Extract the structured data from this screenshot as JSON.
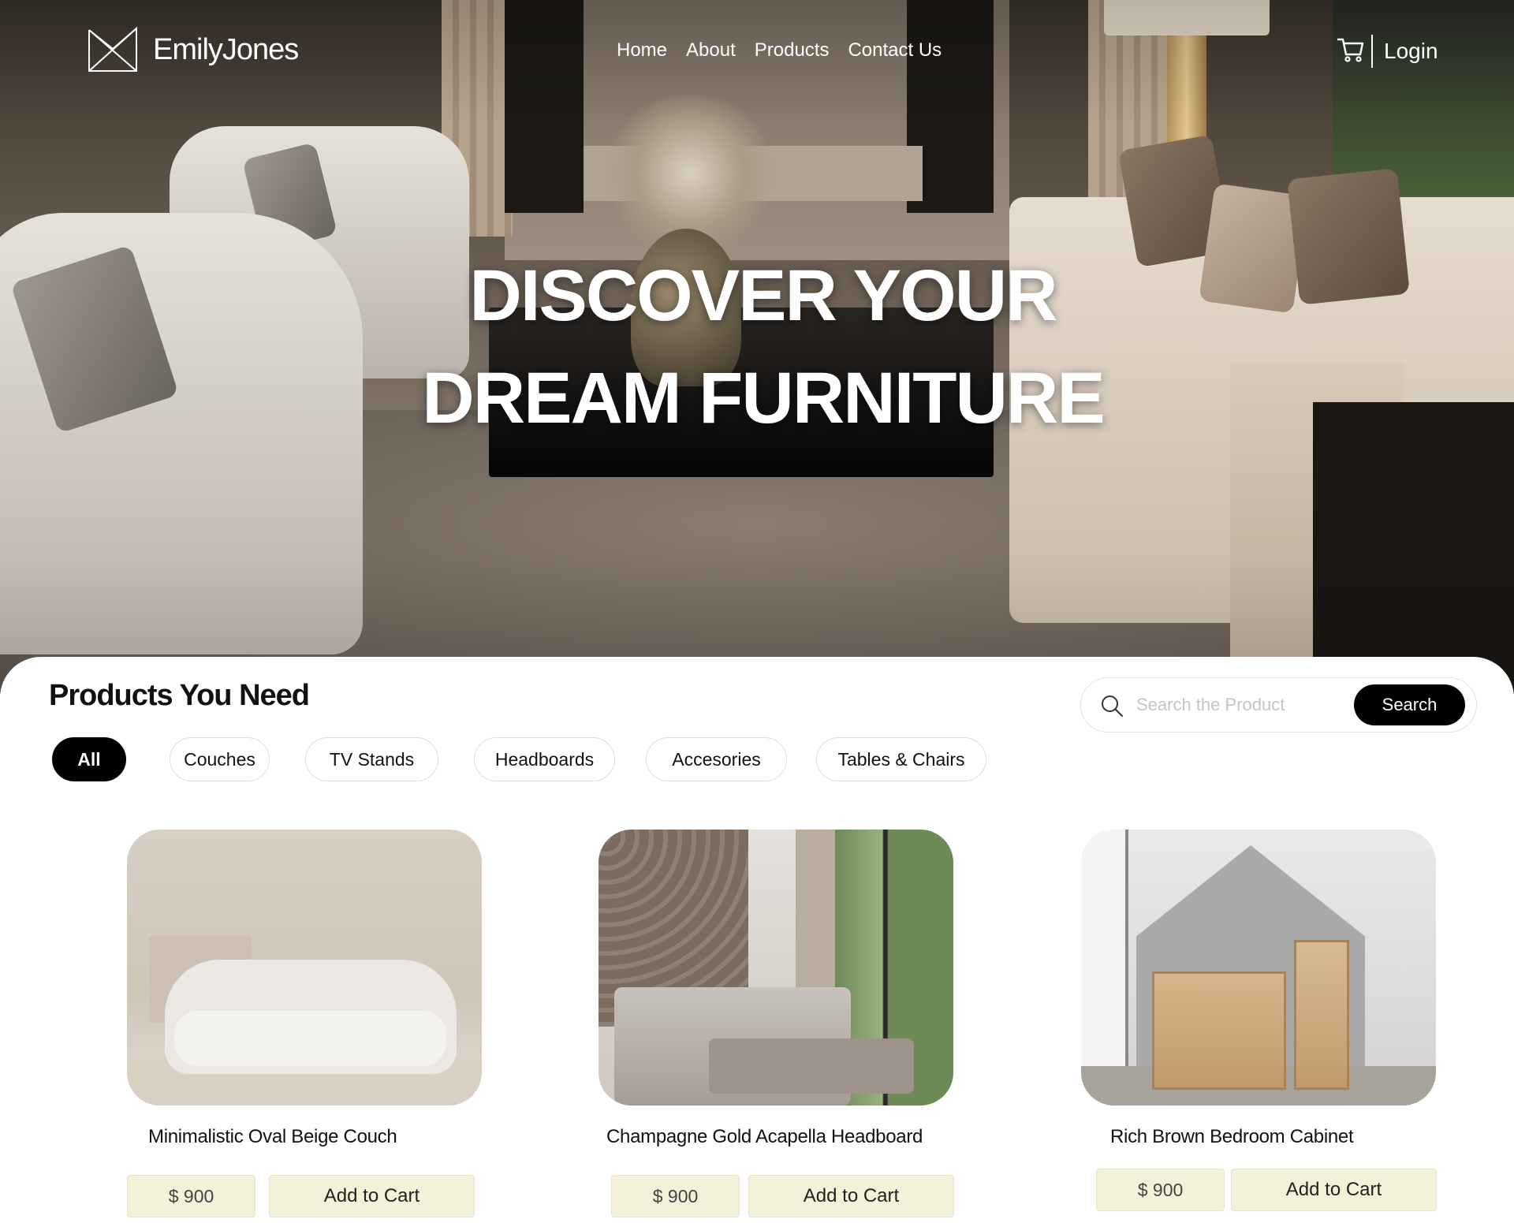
{
  "brand": {
    "name": "EmilyJones"
  },
  "nav": {
    "home": "Home",
    "about": "About",
    "products": "Products",
    "contact": "Contact Us",
    "login": "Login"
  },
  "hero": {
    "line1": "DISCOVER YOUR",
    "line2": "DREAM FURNITURE"
  },
  "products_section": {
    "title": "Products You Need",
    "search": {
      "placeholder": "Search the Product",
      "value": "",
      "button": "Search"
    },
    "filters": [
      "All",
      "Couches",
      "TV Stands",
      "Headboards",
      "Accesories",
      "Tables & Chairs"
    ],
    "active_filter": "All"
  },
  "products": [
    {
      "name": "Minimalistic Oval Beige Couch",
      "price": "$ 900",
      "cta": "Add to Cart"
    },
    {
      "name": "Champagne Gold Acapella Headboard",
      "price": "$ 900",
      "cta": "Add to Cart"
    },
    {
      "name": "Rich Brown Bedroom Cabinet",
      "price": "$ 900",
      "cta": "Add to Cart"
    }
  ],
  "colors": {
    "accent": "#000000",
    "price_bg": "#f3f1d9",
    "hero_text": "#ffffff"
  },
  "icons": {
    "logo": "emilyjones-logo",
    "cart": "cart-icon",
    "search": "search-icon"
  }
}
